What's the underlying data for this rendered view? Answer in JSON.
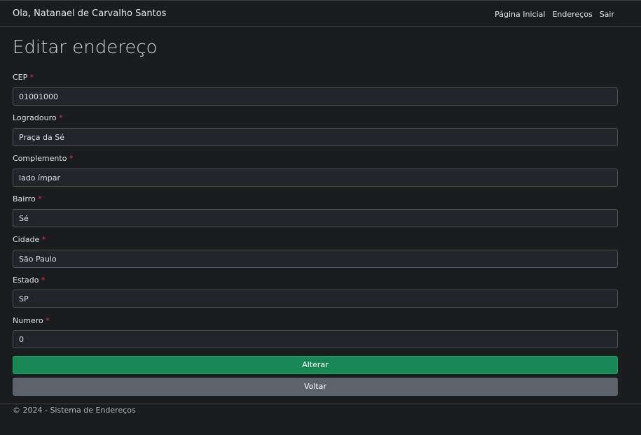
{
  "navbar": {
    "brand": "Ola, Natanael de Carvalho Santos",
    "links": [
      "Página Inicial",
      "Endereços",
      "Sair"
    ]
  },
  "page": {
    "title": "Editar endereço"
  },
  "form": {
    "required_mark": "*",
    "fields": [
      {
        "label": "CEP",
        "value": "01001000"
      },
      {
        "label": "Logradouro",
        "value": "Praça da Sé"
      },
      {
        "label": "Complemento",
        "value": "lado ímpar"
      },
      {
        "label": "Bairro",
        "value": "Sé"
      },
      {
        "label": "Cidade",
        "value": "São Paulo"
      },
      {
        "label": "Estado",
        "value": "SP"
      },
      {
        "label": "Numero",
        "value": "0"
      }
    ],
    "submit_label": "Alterar",
    "back_label": "Voltar"
  },
  "footer": {
    "text": "© 2024 - Sistema de Endereços"
  },
  "colors": {
    "background": "#1b1c1e",
    "success": "#198754",
    "secondary": "#5c636a",
    "required": "#dc3545"
  }
}
